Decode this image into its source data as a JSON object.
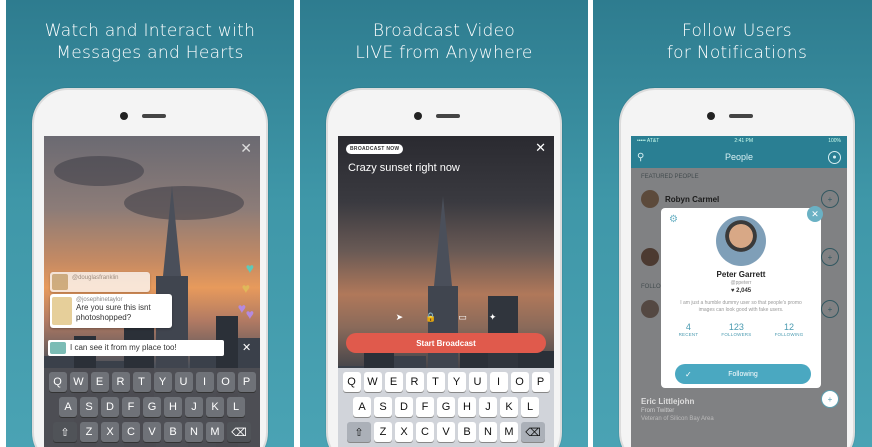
{
  "panels": [
    {
      "caption_line1": "Watch and Interact with",
      "caption_line2": "Messages and Hearts"
    },
    {
      "caption_line1": "Broadcast Video",
      "caption_line2": "LIVE from Anywhere"
    },
    {
      "caption_line1": "Follow Users",
      "caption_line2": "for Notifications"
    }
  ],
  "watch": {
    "close_icon": "✕",
    "msg1_user": "@douglasfranklin",
    "msg2_user": "@josephinetaylor",
    "msg2_text": "Are you sure this isnt photoshopped?",
    "input_text": "I can see it from my place too!",
    "input_close": "✕",
    "heart_colors": [
      "#5fc9b8",
      "#e0b85a",
      "#b48ae0"
    ]
  },
  "broadcast": {
    "badge": "BROADCAST NOW",
    "title": "Crazy sunset right now",
    "close_icon": "✕",
    "start_label": "Start Broadcast"
  },
  "keyboard": {
    "row1": [
      "Q",
      "W",
      "E",
      "R",
      "T",
      "Y",
      "U",
      "I",
      "O",
      "P"
    ],
    "row2": [
      "A",
      "S",
      "D",
      "F",
      "G",
      "H",
      "J",
      "K",
      "L"
    ],
    "row3": [
      "⇧",
      "Z",
      "X",
      "C",
      "V",
      "B",
      "N",
      "M",
      "⌫"
    ]
  },
  "people": {
    "status_left": "••••• AT&T",
    "status_time": "2:41 PM",
    "status_right": "100%",
    "nav_title": "People",
    "featured_label": "FEATURED PEOPLE",
    "featured_name": "Robyn Carmel",
    "following_label": "FOLLO",
    "bottom_name": "Eric Littlejohn",
    "bottom_sub1": "From Twitter",
    "bottom_sub2": "Veteran of Silicon Bay Area",
    "modal": {
      "name": "Peter Garrett",
      "handle": "@ppeterr",
      "hearts": "2,045",
      "bio": "I am just a humble dummy user so that people's promo images can look good with fake users.",
      "stats": [
        {
          "num": "4",
          "label": "RECENT"
        },
        {
          "num": "123",
          "label": "FOLLOWERS"
        },
        {
          "num": "12",
          "label": "FOLLOWING"
        }
      ],
      "follow_label": "Following"
    }
  }
}
